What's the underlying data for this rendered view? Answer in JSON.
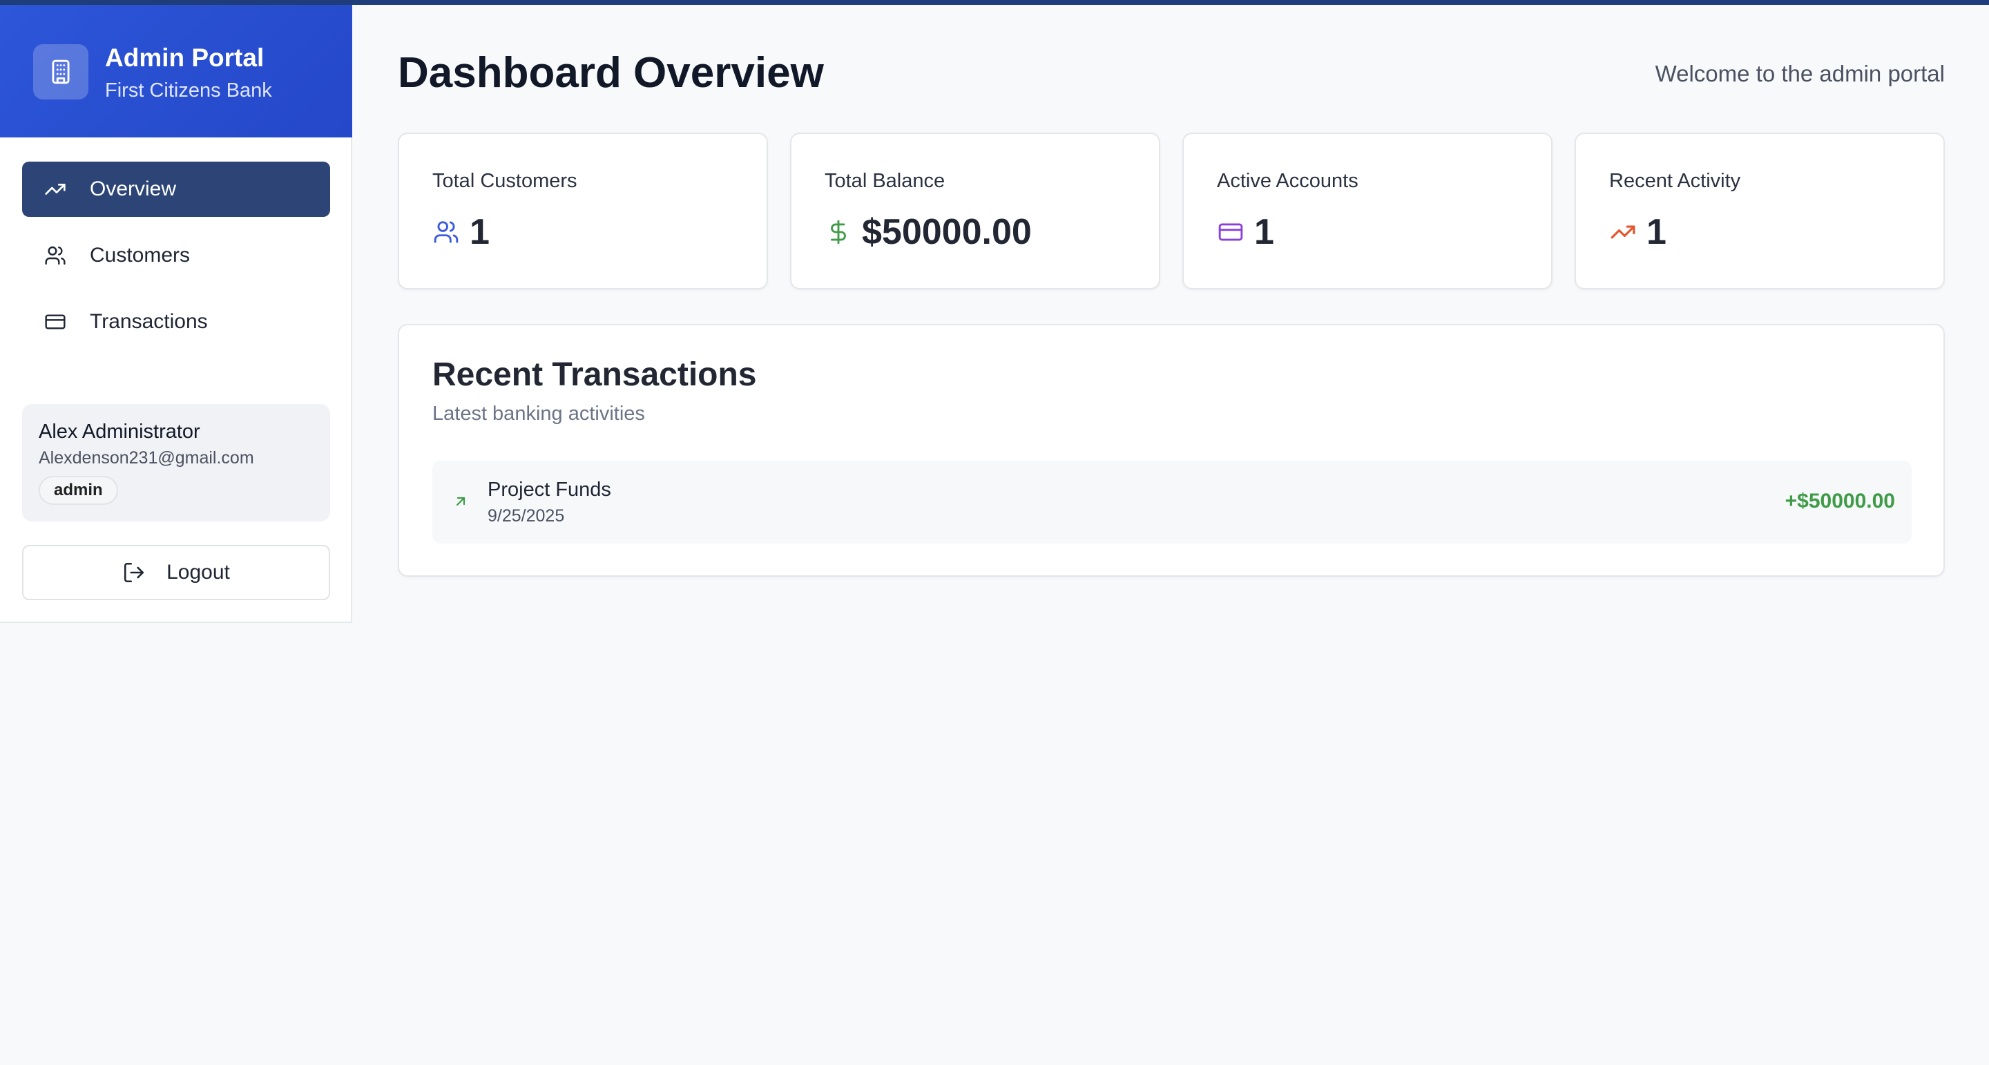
{
  "sidebar": {
    "brand_title": "Admin Portal",
    "brand_subtitle": "First Citizens Bank",
    "nav": [
      {
        "label": "Overview",
        "icon": "trending-up-icon",
        "active": true
      },
      {
        "label": "Customers",
        "icon": "users-icon",
        "active": false
      },
      {
        "label": "Transactions",
        "icon": "credit-card-icon",
        "active": false
      }
    ],
    "user": {
      "name": "Alex Administrator",
      "email": "Alexdenson231@gmail.com",
      "role": "admin"
    },
    "logout_label": "Logout"
  },
  "main": {
    "title": "Dashboard Overview",
    "welcome": "Welcome to the admin portal",
    "stats": [
      {
        "label": "Total Customers",
        "value": "1",
        "icon": "users-icon",
        "color": "#3b5bdb"
      },
      {
        "label": "Total Balance",
        "value": "$50000.00",
        "icon": "dollar-icon",
        "color": "#3f9b47"
      },
      {
        "label": "Active Accounts",
        "value": "1",
        "icon": "credit-card-icon",
        "color": "#8b3fd9"
      },
      {
        "label": "Recent Activity",
        "value": "1",
        "icon": "trending-up-icon",
        "color": "#e4572e"
      }
    ],
    "recent_transactions": {
      "title": "Recent Transactions",
      "subtitle": "Latest banking activities",
      "items": [
        {
          "name": "Project Funds",
          "date": "9/25/2025",
          "amount": "+$50000.00",
          "icon": "arrow-up-right-icon"
        }
      ]
    }
  },
  "colors": {
    "brand": "#2d56d8",
    "nav_active": "#2c4476",
    "positive": "#3f9b47"
  }
}
